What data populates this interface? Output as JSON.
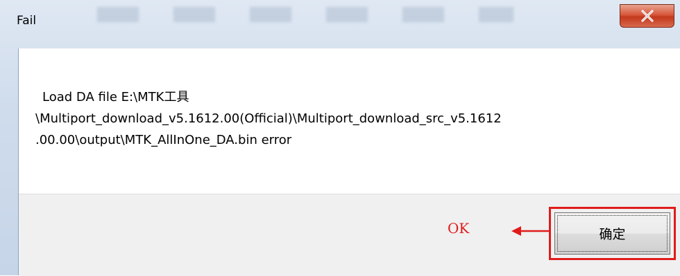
{
  "window": {
    "title": "Fail",
    "close_label": "X"
  },
  "message": {
    "line1": "Load DA file E:\\MTK工具",
    "line2": "\\Multiport_download_v5.1612.00(Official)\\Multiport_download_src_v5.1612",
    "line3": ".00.00\\output\\MTK_AllInOne_DA.bin error"
  },
  "buttons": {
    "confirm_label": "确定"
  },
  "annotation": {
    "ok_label": "OK",
    "color": "#e11b1b"
  },
  "icons": {
    "close": "close-icon",
    "arrow": "arrow-left-icon"
  }
}
